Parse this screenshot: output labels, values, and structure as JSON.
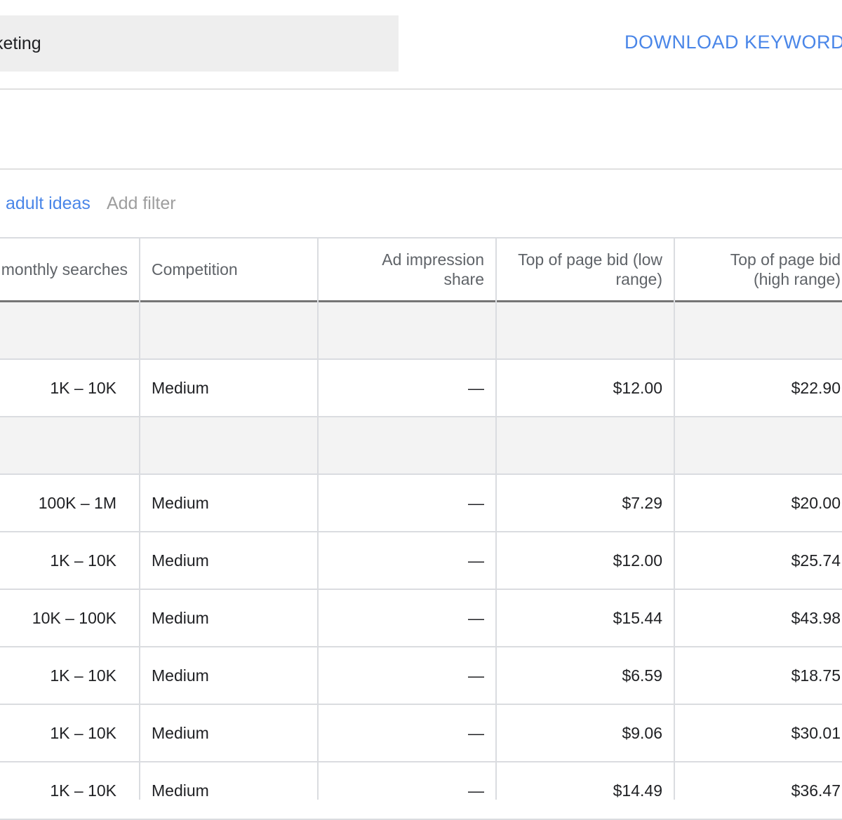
{
  "search": {
    "value": "keting"
  },
  "toolbar": {
    "download_label": "DOWNLOAD KEYWORD I"
  },
  "filters": {
    "chip_label": "adult ideas",
    "add_filter_label": "Add filter"
  },
  "table": {
    "headers": {
      "monthly_searches": "monthly searches",
      "competition": "Competition",
      "ad_impression_share_line1": "Ad impression",
      "ad_impression_share_line2": "share",
      "bid_low_line1": "Top of page bid (low",
      "bid_low_line2": "range)",
      "bid_high_line1": "Top of page bid",
      "bid_high_line2": "(high range)"
    },
    "rows": [
      {
        "type": "group"
      },
      {
        "type": "data",
        "searches": "1K – 10K",
        "competition": "Medium",
        "share": "—",
        "low": "$12.00",
        "high": "$22.90"
      },
      {
        "type": "group"
      },
      {
        "type": "data",
        "searches": "100K – 1M",
        "competition": "Medium",
        "share": "—",
        "low": "$7.29",
        "high": "$20.00"
      },
      {
        "type": "data",
        "searches": "1K – 10K",
        "competition": "Medium",
        "share": "—",
        "low": "$12.00",
        "high": "$25.74"
      },
      {
        "type": "data",
        "searches": "10K – 100K",
        "competition": "Medium",
        "share": "—",
        "low": "$15.44",
        "high": "$43.98"
      },
      {
        "type": "data",
        "searches": "1K – 10K",
        "competition": "Medium",
        "share": "—",
        "low": "$6.59",
        "high": "$18.75"
      },
      {
        "type": "data",
        "searches": "1K – 10K",
        "competition": "Medium",
        "share": "—",
        "low": "$9.06",
        "high": "$30.01"
      },
      {
        "type": "data",
        "searches": "1K – 10K",
        "competition": "Medium",
        "share": "—",
        "low": "$14.49",
        "high": "$36.47"
      }
    ]
  }
}
